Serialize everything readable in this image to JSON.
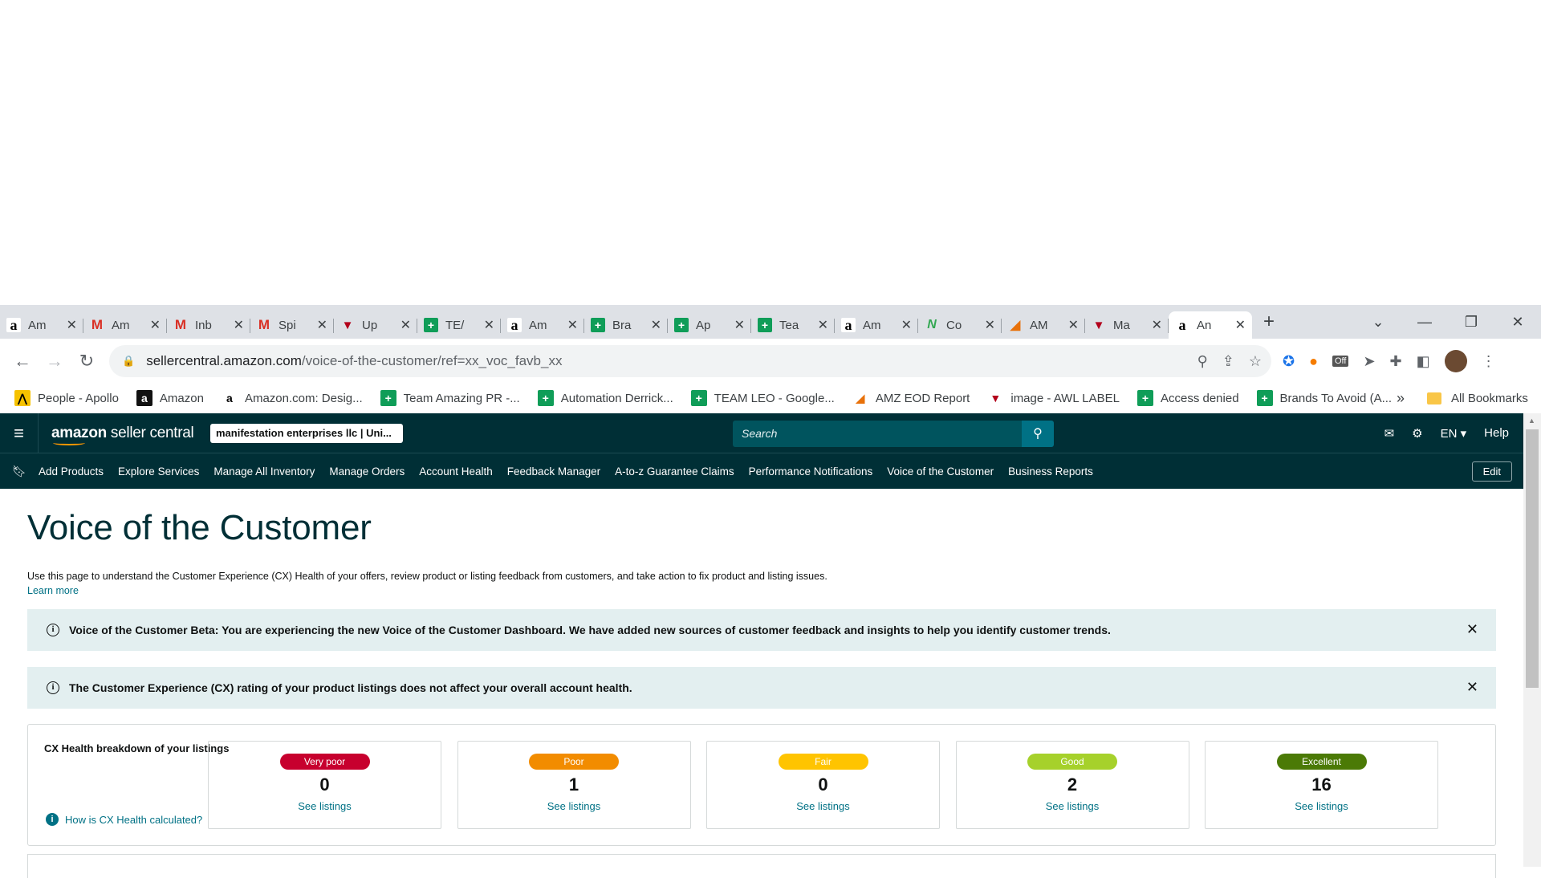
{
  "browser": {
    "tabs": [
      {
        "icon": "amazon",
        "title": "Am"
      },
      {
        "icon": "gmail",
        "title": "Am"
      },
      {
        "icon": "gmail",
        "title": "Inb"
      },
      {
        "icon": "gmail",
        "title": "Spi"
      },
      {
        "icon": "red",
        "title": "Up"
      },
      {
        "icon": "sheet",
        "title": "TE/"
      },
      {
        "icon": "amazon",
        "title": "Am"
      },
      {
        "icon": "sheet",
        "title": "Bra"
      },
      {
        "icon": "sheet",
        "title": "Ap"
      },
      {
        "icon": "sheet",
        "title": "Tea"
      },
      {
        "icon": "amazon",
        "title": "Am"
      },
      {
        "icon": "green",
        "title": "Co"
      },
      {
        "icon": "orange",
        "title": "AM"
      },
      {
        "icon": "red",
        "title": "Ma"
      },
      {
        "icon": "amazon",
        "title": "An",
        "active": true
      }
    ],
    "url_host": "sellercentral.amazon.com",
    "url_path": "/voice-of-the-customer/ref=xx_voc_favb_xx",
    "ext_badge": "Off",
    "bookmarks": [
      {
        "icon": "apollo",
        "label": "People - Apollo"
      },
      {
        "icon": "amazon-dark",
        "label": "Amazon"
      },
      {
        "icon": "amazon",
        "label": "Amazon.com: Desig..."
      },
      {
        "icon": "sheet",
        "label": "Team Amazing PR -..."
      },
      {
        "icon": "sheet",
        "label": "Automation Derrick..."
      },
      {
        "icon": "sheet",
        "label": "TEAM LEO - Google..."
      },
      {
        "icon": "orange",
        "label": "AMZ EOD Report"
      },
      {
        "icon": "red",
        "label": "image - AWL LABEL"
      },
      {
        "icon": "sheet",
        "label": "Access denied"
      },
      {
        "icon": "sheet",
        "label": "Brands To Avoid (A..."
      }
    ],
    "more_bookmarks": "»",
    "all_bookmarks": "All Bookmarks"
  },
  "header": {
    "logo_bold": "amazon",
    "logo_rest": " seller central",
    "account": "manifestation enterprises llc | Uni...",
    "search_placeholder": "Search",
    "language": "EN",
    "help": "Help"
  },
  "nav": {
    "items": [
      "Add Products",
      "Explore Services",
      "Manage All Inventory",
      "Manage Orders",
      "Account Health",
      "Feedback Manager",
      "A-to-z Guarantee Claims",
      "Performance Notifications",
      "Voice of the Customer",
      "Business Reports"
    ],
    "edit": "Edit"
  },
  "page": {
    "title": "Voice of the Customer",
    "description": "Use this page to understand the Customer Experience (CX) Health of your offers, review product or listing feedback from customers, and take action to fix product and listing issues.",
    "learn_more": "Learn more",
    "alert_beta": "Voice of the Customer Beta: You are experiencing the new Voice of the Customer Dashboard. We have added new sources of customer feedback and insights to help you identify customer trends.",
    "alert_cx": "The Customer Experience (CX) rating of your product listings does not affect your overall account health."
  },
  "cx": {
    "title": "CX Health breakdown of your listings",
    "help_link": "How is CX Health calculated?",
    "see_listings": "See listings",
    "cards": [
      {
        "label": "Very poor",
        "count": "0",
        "color": "#c7002e"
      },
      {
        "label": "Poor",
        "count": "1",
        "color": "#f28c00"
      },
      {
        "label": "Fair",
        "count": "0",
        "color": "#ffc400"
      },
      {
        "label": "Good",
        "count": "2",
        "color": "#a6d12b"
      },
      {
        "label": "Excellent",
        "count": "16",
        "color": "#4b7a06"
      }
    ]
  }
}
